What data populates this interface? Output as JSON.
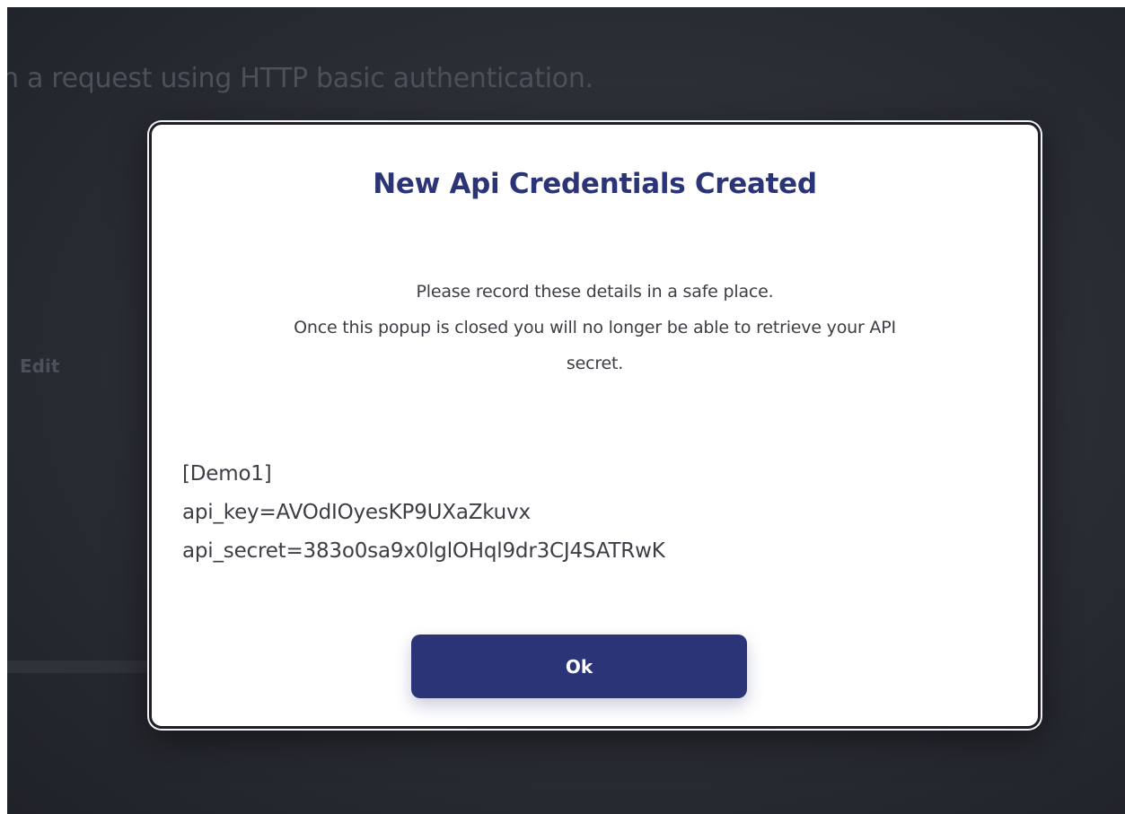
{
  "background": {
    "line1": "n a request using HTTP basic authentication.",
    "line2": "Edit"
  },
  "modal": {
    "title": "New Api Credentials Created",
    "message_lines": [
      "Please record these details in a safe place.",
      "Once this popup is closed you will no longer be able to retrieve your API",
      "secret."
    ],
    "credentials": {
      "profile": "[Demo1]",
      "api_key": "api_key=AVOdIOyesKP9UXaZkuvx",
      "api_secret": "api_secret=383o0sa9x0lglOHql9dr3CJ4SATRwK"
    },
    "ok_label": "Ok"
  },
  "colors": {
    "accent": "#2c3478",
    "overlay": "#2c2f36",
    "modal_bg": "#ffffff",
    "text": "#3d3d45"
  }
}
